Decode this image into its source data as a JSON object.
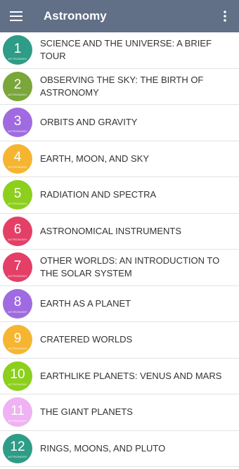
{
  "header": {
    "title": "Astronomy",
    "menu_icon": "hamburger-menu-icon",
    "overflow_icon": "more-vert-icon",
    "background": "#616f87"
  },
  "chapters": [
    {
      "number": "1",
      "badge_text": "ASTRONOMY",
      "title": "SCIENCE AND THE UNIVERSE: A BRIEF TOUR",
      "color": "#2e9c86"
    },
    {
      "number": "2",
      "badge_text": "ASTRONOMY",
      "title": "OBSERVING THE SKY: THE BIRTH OF ASTRONOMY",
      "color": "#7aa63a"
    },
    {
      "number": "3",
      "badge_text": "ASTRONOMY",
      "title": "ORBITS AND GRAVITY",
      "color": "#a06be0"
    },
    {
      "number": "4",
      "badge_text": "ASTRONOMY",
      "title": "EARTH, MOON, AND SKY",
      "color": "#f6b531"
    },
    {
      "number": "5",
      "badge_text": "ASTRONOMY",
      "title": "RADIATION AND SPECTRA",
      "color": "#8ccf1c"
    },
    {
      "number": "6",
      "badge_text": "ASTRONOMY",
      "title": "ASTRONOMICAL INSTRUMENTS",
      "color": "#e43f67"
    },
    {
      "number": "7",
      "badge_text": "ASTRONOMY",
      "title": "OTHER WORLDS: AN INTRODUCTION TO THE SOLAR SYSTEM",
      "color": "#e43f67"
    },
    {
      "number": "8",
      "badge_text": "ASTRONOMY",
      "title": "EARTH AS A PLANET",
      "color": "#a06be0"
    },
    {
      "number": "9",
      "badge_text": "ASTRONOMY",
      "title": "CRATERED WORLDS",
      "color": "#f6b531"
    },
    {
      "number": "10",
      "badge_text": "ASTRONOMY",
      "title": "EARTHLIKE PLANETS: VENUS AND MARS",
      "color": "#8ccf1c"
    },
    {
      "number": "11",
      "badge_text": "ASTRONOMY",
      "title": "THE GIANT PLANETS",
      "color": "#efb2f2"
    },
    {
      "number": "12",
      "badge_text": "ASTRONOMY",
      "title": "RINGS, MOONS, AND PLUTO",
      "color": "#2e9c86"
    }
  ]
}
